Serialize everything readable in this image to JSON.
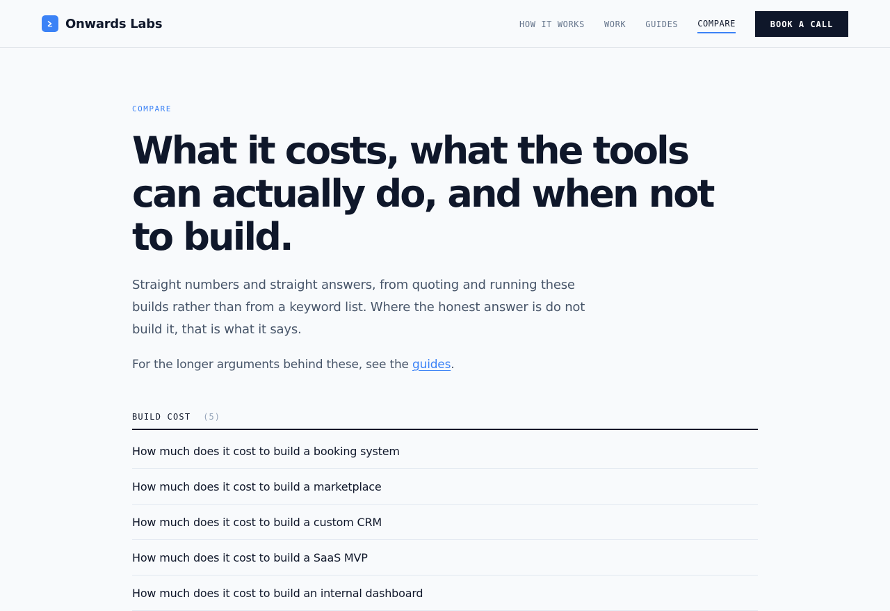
{
  "header": {
    "brand_name": "Onwards Labs",
    "brand_icon": "chevron-right-icon",
    "nav": [
      {
        "label": "HOW IT WORKS",
        "active": false
      },
      {
        "label": "WORK",
        "active": false
      },
      {
        "label": "GUIDES",
        "active": false
      },
      {
        "label": "COMPARE",
        "active": true
      }
    ],
    "cta_label": "BOOK A CALL"
  },
  "hero": {
    "eyebrow": "COMPARE",
    "title": "What it costs, what the tools can actually do, and when not to build.",
    "lede": "Straight numbers and straight answers, from quoting and running these builds rather than from a keyword list. Where the honest answer is do not build it, that is what it says.",
    "more_prefix": "For the longer arguments behind these, see the ",
    "more_link": "guides",
    "more_suffix": "."
  },
  "section": {
    "title": "BUILD COST",
    "count": "(5)",
    "items": [
      "How much does it cost to build a booking system",
      "How much does it cost to build a marketplace",
      "How much does it cost to build a custom CRM",
      "How much does it cost to build a SaaS MVP",
      "How much does it cost to build an internal dashboard"
    ]
  },
  "colors": {
    "accent": "#3b82f6",
    "ink": "#0f172a",
    "muted": "#475569",
    "background": "#f8fafc"
  }
}
